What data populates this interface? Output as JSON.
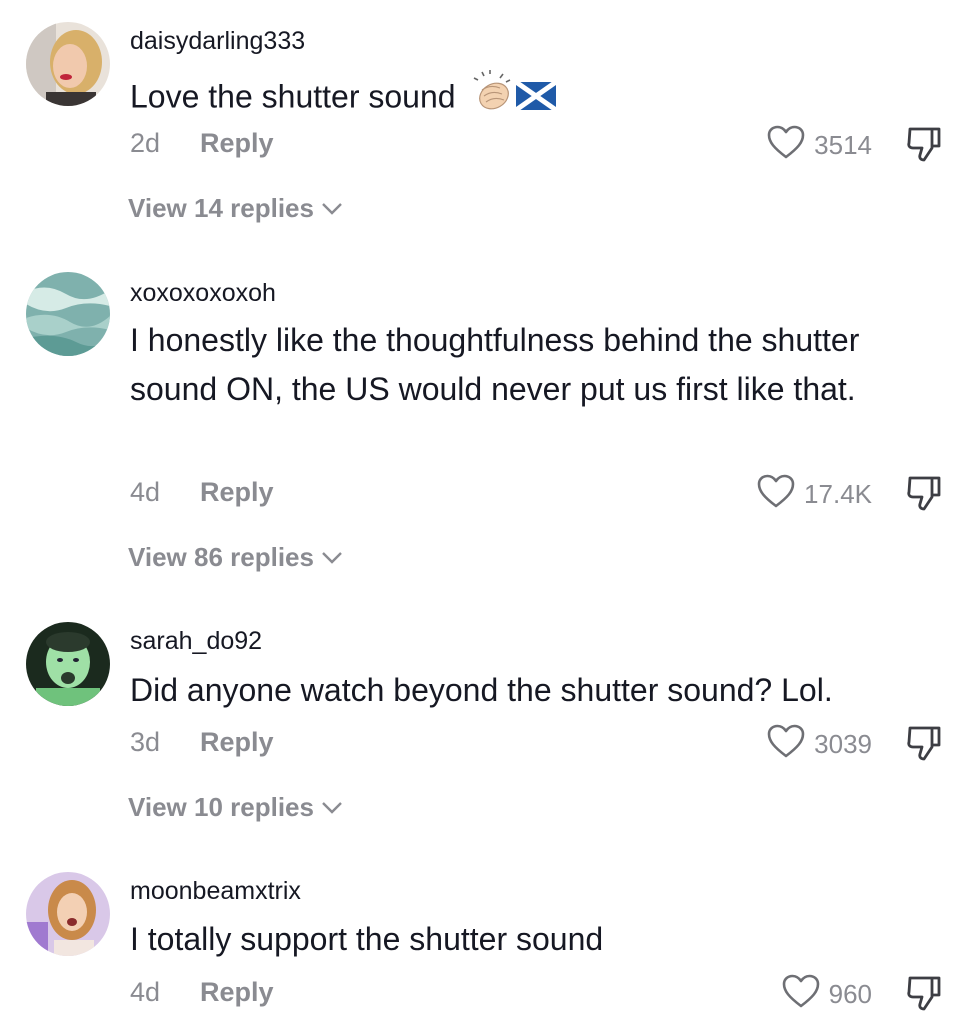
{
  "comments": [
    {
      "username": "daisydarling333",
      "text": "Love the shutter sound",
      "emojis": [
        "clapping-hands-icon",
        "scotland-flag-icon"
      ],
      "age": "2d",
      "reply_label": "Reply",
      "likes": "3514",
      "view_replies": "View 14 replies"
    },
    {
      "username": "xoxoxoxoxoh",
      "text": "I honestly like the thoughtfulness behind the shutter sound ON, the US would never put us first like that.",
      "age": "4d",
      "reply_label": "Reply",
      "likes": "17.4K",
      "view_replies": "View 86 replies"
    },
    {
      "username": "sarah_do92",
      "text": "Did anyone watch beyond the shutter sound? Lol.",
      "age": "3d",
      "reply_label": "Reply",
      "likes": "3039",
      "view_replies": "View 10 replies"
    },
    {
      "username": "moonbeamxtrix",
      "text": "I totally support the shutter sound",
      "age": "4d",
      "reply_label": "Reply",
      "likes": "960"
    }
  ],
  "colors": {
    "text_primary": "#161823",
    "text_secondary": "#8a8b91",
    "background": "#ffffff"
  }
}
